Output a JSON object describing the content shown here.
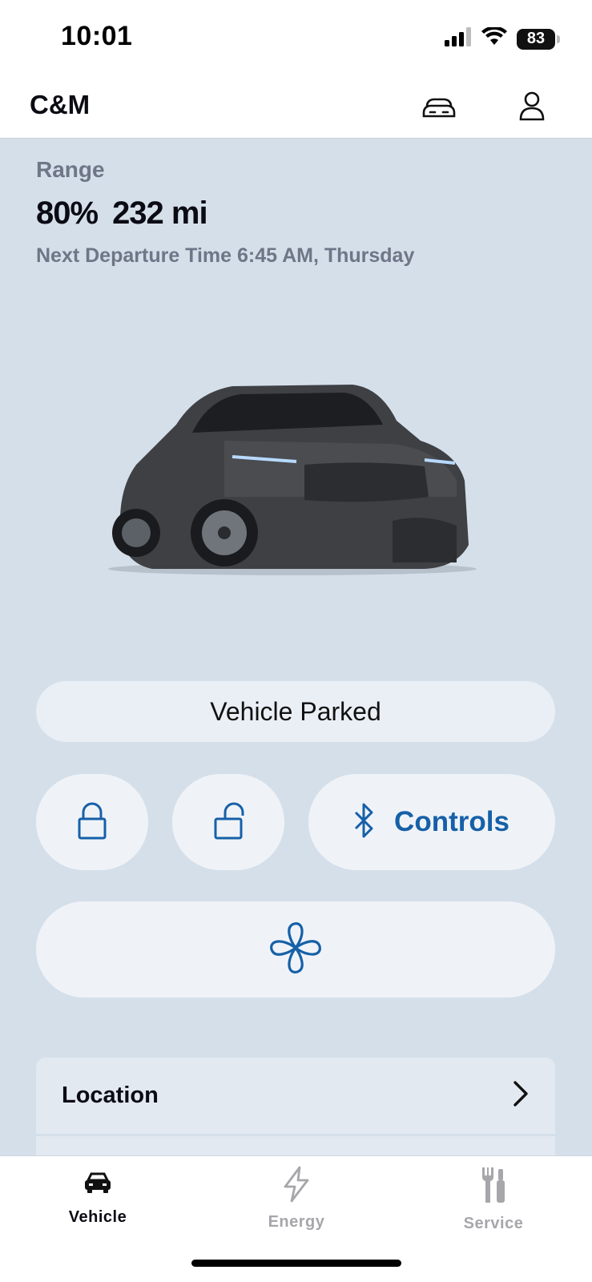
{
  "status_bar": {
    "time": "10:01",
    "battery": "83"
  },
  "header": {
    "title": "C&M",
    "garage_icon": "car-garage-icon",
    "profile_icon": "person-icon"
  },
  "vehicle": {
    "range_label": "Range",
    "charge_percent": "80%",
    "range_miles": "232 mi",
    "departure_text": "Next Departure Time 6:45 AM, Thursday",
    "status": "Vehicle Parked"
  },
  "actions": {
    "controls_label": "Controls"
  },
  "sections": {
    "location_label": "Location"
  },
  "tabs": [
    {
      "label": "Vehicle",
      "active": true
    },
    {
      "label": "Energy",
      "active": false
    },
    {
      "label": "Service",
      "active": false
    }
  ],
  "colors": {
    "accent": "#1660a8",
    "background": "#d5dfea",
    "pill": "#eff3f8"
  }
}
